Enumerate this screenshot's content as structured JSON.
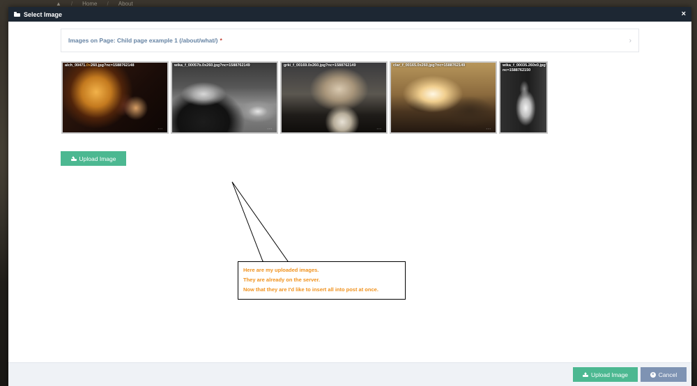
{
  "background": {
    "breadcrumbs": [
      "Home",
      "About"
    ]
  },
  "modal": {
    "title": "Select Image",
    "close_label": "×"
  },
  "page_panel": {
    "label": "Images on Page: Child page example 1 (/about/what/)",
    "required_mark": "*",
    "chevron": "›"
  },
  "images": [
    {
      "filename": "alch_00471.",
      "highlight": "0x",
      "rest": "260.jpg?nc=1588762148"
    },
    {
      "filename": "wika_f_00057b.0x260.jpg?nc=1588762149",
      "highlight": "",
      "rest": ""
    },
    {
      "filename": "grki_f_00169.0x260.jpg?nc=1588762149",
      "highlight": "",
      "rest": ""
    },
    {
      "filename": "clar_f_00165.0x260.jpg?nc=1588762149",
      "highlight": "",
      "rest": ""
    },
    {
      "filename": "wika_f_00035.260x0.jpg?nc=1588762150",
      "highlight": "",
      "rest": ""
    }
  ],
  "buttons": {
    "upload_inline": "Upload Image",
    "upload_footer": "Upload Image",
    "cancel": "Cancel"
  },
  "callout": {
    "lines": [
      "Here are my uploaded images.",
      "They are already on the server.",
      "Now that they are I'd like to insert all into post at once."
    ]
  },
  "colors": {
    "header_bg": "#1d2733",
    "accent_green": "#4cb891",
    "accent_slate": "#7e93b3",
    "callout_text": "#f0921e",
    "panel_text": "#6583a3"
  }
}
